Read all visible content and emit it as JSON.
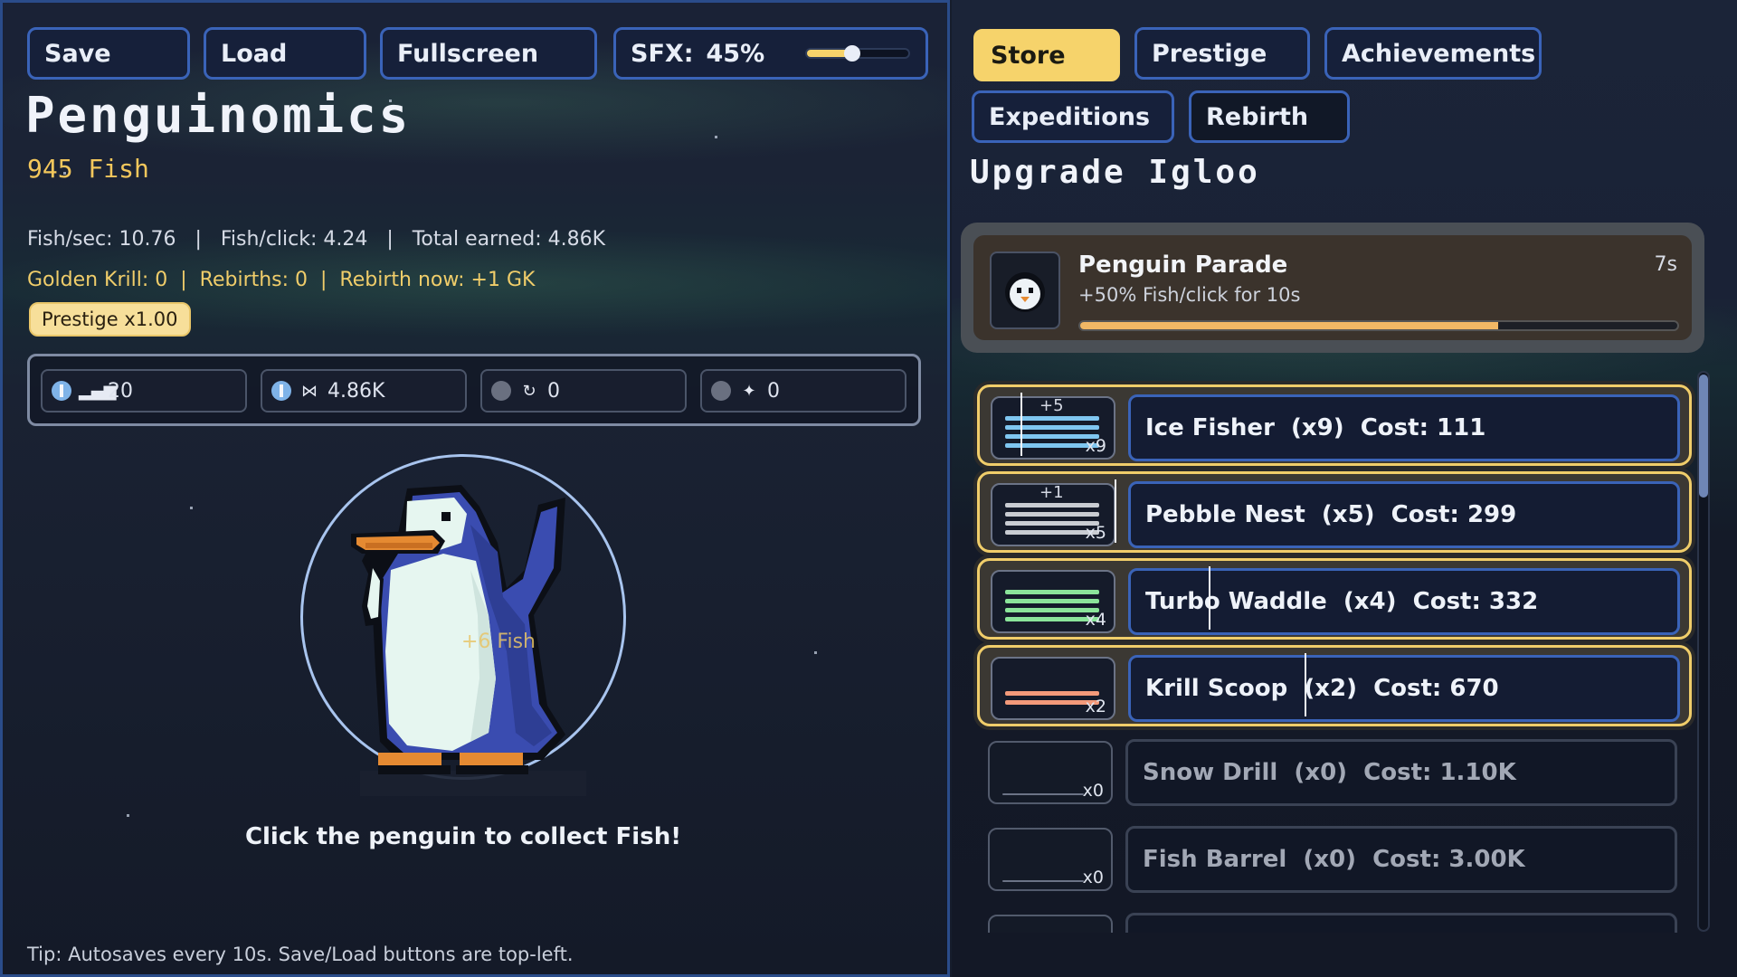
{
  "toolbar": {
    "save_label": "Save",
    "load_label": "Load",
    "fullscreen_label": "Fullscreen",
    "sfx_label": "SFX:",
    "sfx_value": "45%",
    "sfx_level": 0.45
  },
  "game": {
    "title": "Penguinomics",
    "fish_count": "945 Fish",
    "stats_line1": "Fish/sec: 10.76   |   Fish/click: 4.24   |   Total earned: 4.86K",
    "stats_line2": "Golden Krill: 0  |  Rebirths: 0  |  Rebirth now: +1 GK",
    "prestige_badge": "Prestige x1.00",
    "resources": [
      {
        "icon": "penguin-count-icon",
        "value": "20"
      },
      {
        "icon": "fish-icon",
        "value": "4.86K"
      },
      {
        "icon": "cycle-icon",
        "value": "0"
      },
      {
        "icon": "sparkle-icon",
        "value": "0"
      }
    ],
    "floating_text": "+6 Fish",
    "click_hint": "Click the penguin to collect Fish!",
    "tip": "Tip: Autosaves every 10s. Save/Load buttons are top-left."
  },
  "tabs": {
    "store": "Store",
    "prestige": "Prestige",
    "achievements": "Achievements",
    "expeditions": "Expeditions",
    "rebirth": "Rebirth",
    "active": "Store"
  },
  "store": {
    "section_title": "Upgrade Igloo",
    "event": {
      "name": "Penguin Parade",
      "description": "+50% Fish/click for 10s",
      "time_left": "7s",
      "progress": 0.7
    },
    "upgrades": [
      {
        "label": "Ice Fisher  (x9)  Cost: 111",
        "count": "x9",
        "plus": "+5",
        "color": "#7fc6f0"
      },
      {
        "label": "Pebble Nest  (x5)  Cost: 299",
        "count": "x5",
        "plus": "+1",
        "color": "#c9ccd2"
      },
      {
        "label": "Turbo Waddle  (x4)  Cost: 332",
        "count": "x4",
        "plus": "",
        "color": "#8be49a"
      },
      {
        "label": "Krill Scoop  (x2)  Cost: 670",
        "count": "x2",
        "plus": "",
        "color": "#f39a7a"
      },
      {
        "label": "Snow Drill  (x0)  Cost: 1.10K",
        "count": "x0",
        "plus": "",
        "color": "#6b7386"
      },
      {
        "label": "Fish Barrel  (x0)  Cost: 3.00K",
        "count": "x0",
        "plus": "",
        "color": "#6b7386"
      }
    ]
  },
  "colors": {
    "accent": "#f6d36b",
    "border_blue": "#3a63b8",
    "gold": "#f0cd6a"
  }
}
